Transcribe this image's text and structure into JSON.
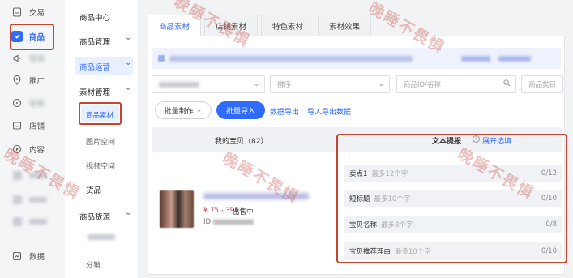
{
  "rail": {
    "items": [
      {
        "label": "交易",
        "icon": "receipt-icon"
      },
      {
        "label": "商品",
        "icon": "product-icon"
      },
      {
        "label": "营销",
        "icon": "megaphone-icon"
      },
      {
        "label": "推广",
        "icon": "location-icon"
      },
      {
        "label": "客服",
        "icon": "service-icon"
      },
      {
        "label": "店铺",
        "icon": "shop-icon"
      },
      {
        "label": "内容",
        "icon": "content-icon"
      },
      {
        "label": "数据",
        "icon": "chart-icon"
      }
    ]
  },
  "subnav": {
    "product_center": "商品中心",
    "product_manage": "商品管理",
    "product_ops": "商品运营",
    "material_manage": "素材管理",
    "product_material": "商品素材",
    "image_space": "图片空间",
    "video_space": "视频空间",
    "partial_goods": "货品",
    "goods_source": "商品货源",
    "distribution": "分销"
  },
  "tabs": [
    "商品素材",
    "店铺素材",
    "特色素材",
    "素材效果"
  ],
  "filters": {
    "sort_placeholder": "排序",
    "search_placeholder": "商品ID/名称",
    "category_placeholder": "商品类目"
  },
  "actions": {
    "batch_make": "批量制作",
    "batch_import": "批量导入",
    "data_export": "数据导出",
    "import_export_data": "导入导出数据"
  },
  "table": {
    "col_my_baby": "我的宝贝（82）",
    "col_text": "文本提报",
    "expand_options": "展开选填"
  },
  "product": {
    "price": "¥ 75 - 396",
    "status": "出售中",
    "id_label": "ID"
  },
  "text_fields": [
    {
      "label": "卖点1",
      "placeholder": "最多12个字",
      "count": "0/12"
    },
    {
      "label": "短标题",
      "placeholder": "最多10个字",
      "count": "0/10"
    },
    {
      "label": "宝贝名称",
      "placeholder": "最多8个字",
      "count": "0/8"
    },
    {
      "label": "宝贝推荐理由",
      "placeholder": "最多10个字",
      "count": "0/10"
    }
  ],
  "watermark": "晚睡不畏惧",
  "colors": {
    "accent": "#2f6bff",
    "highlight_border": "#c8442f",
    "price": "#e23d3d"
  }
}
